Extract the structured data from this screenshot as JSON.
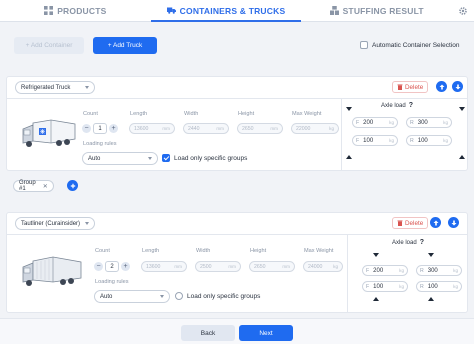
{
  "tabs": [
    {
      "label": "PRODUCTS",
      "icon": "products-grid-icon",
      "active": false
    },
    {
      "label": "CONTAINERS & TRUCKS",
      "icon": "truck-icon",
      "active": true
    },
    {
      "label": "STUFFING RESULT",
      "icon": "boxes-icon",
      "active": false
    }
  ],
  "toolbar": {
    "add_container": "+ Add Container",
    "add_truck": "+ Add Truck",
    "auto_selection": "Automatic Container Selection",
    "auto_selection_checked": false
  },
  "containers": [
    {
      "type": "Refrigerated Truck",
      "delete_label": "Delete",
      "count_label": "Count",
      "count": "1",
      "length_label": "Length",
      "length": "13600",
      "width_label": "Width",
      "width": "2440",
      "height_label": "Height",
      "height": "2650",
      "max_weight_label": "Max Weight",
      "max_weight": "22000",
      "unit_mm": "mm",
      "unit_kg": "kg",
      "loading_rules_label": "Loading rules",
      "loading_rule": "Auto",
      "groups_only_label": "Load only specific groups",
      "groups_only_checked": true,
      "axle_title": "Axle load",
      "axle": [
        {
          "tag": "F",
          "value": "200"
        },
        {
          "tag": "R",
          "value": "300"
        },
        {
          "tag": "F",
          "value": "100"
        },
        {
          "tag": "R",
          "value": "100"
        }
      ]
    },
    {
      "type": "Tautliner (Curainsider)",
      "delete_label": "Delete",
      "count_label": "Count",
      "count": "2",
      "length_label": "Length",
      "length": "13600",
      "width_label": "Width",
      "width": "2500",
      "height_label": "Height",
      "height": "2650",
      "max_weight_label": "Max Weight",
      "max_weight": "24000",
      "unit_mm": "mm",
      "unit_kg": "kg",
      "loading_rules_label": "Loading rules",
      "loading_rule": "Auto",
      "groups_only_label": "Load only specific groups",
      "groups_only_checked": false,
      "axle_title": "Axle load",
      "axle": [
        {
          "tag": "F",
          "value": "200"
        },
        {
          "tag": "R",
          "value": "300"
        },
        {
          "tag": "F",
          "value": "100"
        },
        {
          "tag": "R",
          "value": "100"
        }
      ]
    }
  ],
  "group_chip": "Group #1",
  "footer": {
    "back": "Back",
    "next": "Next"
  },
  "colors": {
    "accent": "#1f6bf0",
    "danger": "#d9534f",
    "background": "#f1f3f7"
  }
}
